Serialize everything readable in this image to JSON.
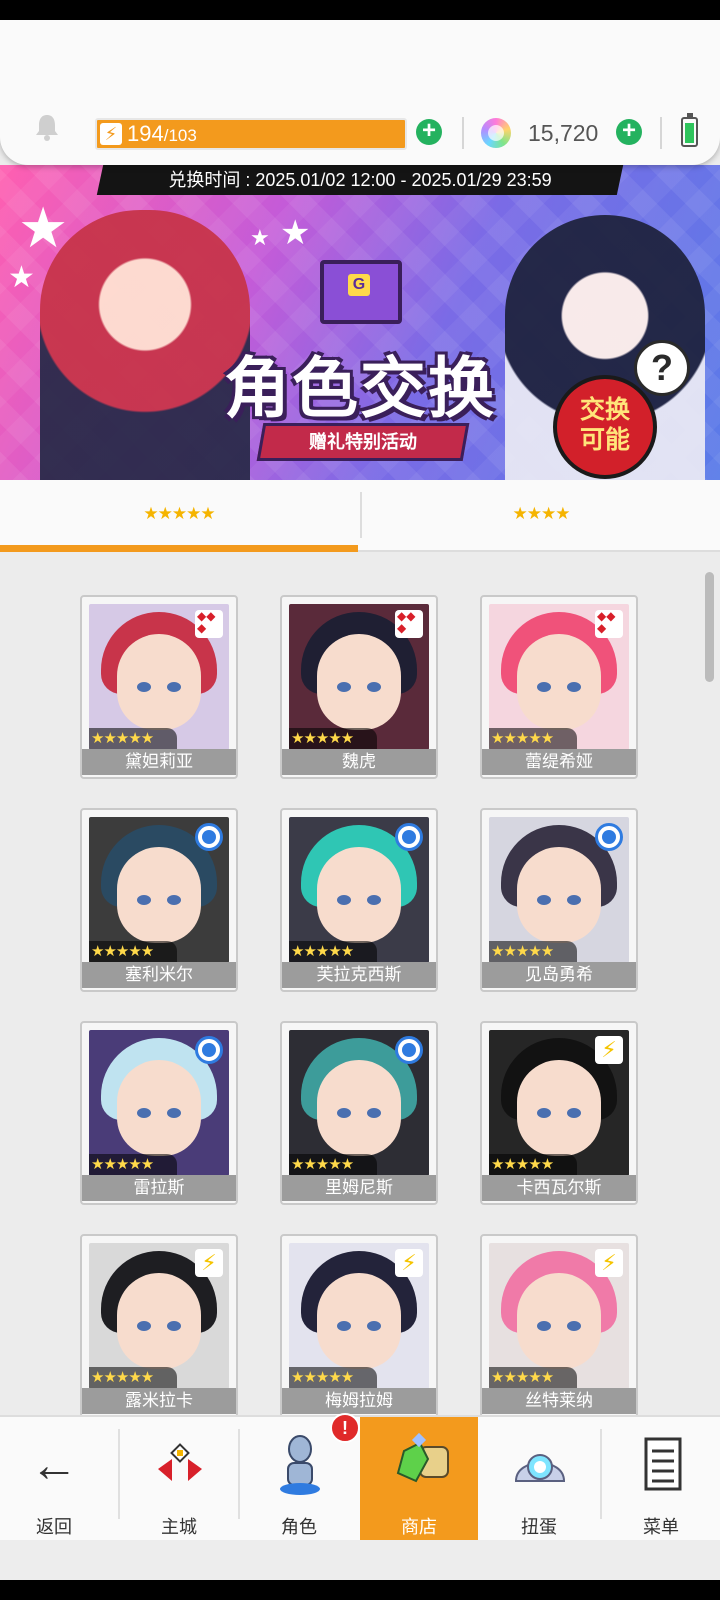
{
  "status": {
    "stamina_current": "194",
    "stamina_max": "/103",
    "gems": "15,720"
  },
  "banner": {
    "period": "兑换时间 : 2025.01/02 12:00 - 2025.01/29 23:59",
    "title": "角色交换",
    "subtitle": "赠礼特别活动",
    "badge_line1": "交换",
    "badge_line2": "可能",
    "help": "?"
  },
  "tabs": [
    {
      "label": "★★★★★",
      "active": true
    },
    {
      "label": "★★★★",
      "active": false
    }
  ],
  "characters": [
    {
      "name": "黛妲莉亚",
      "stars": "★★★★★",
      "type": "fire",
      "hair": "#c8344a",
      "bg": "#d6c9e6"
    },
    {
      "name": "魏虎",
      "stars": "★★★★★",
      "type": "fire",
      "hair": "#1f1f33",
      "bg": "#5a2a3a"
    },
    {
      "name": "蕾缇希娅",
      "stars": "★★★★★",
      "type": "fire",
      "hair": "#f0527a",
      "bg": "#f5d6df"
    },
    {
      "name": "塞利米尔",
      "stars": "★★★★★",
      "type": "water",
      "hair": "#2a4a62",
      "bg": "#3c3c3c"
    },
    {
      "name": "芙拉克西斯",
      "stars": "★★★★★",
      "type": "water",
      "hair": "#2fc6b4",
      "bg": "#3b3b48"
    },
    {
      "name": "见岛勇希",
      "stars": "★★★★★",
      "type": "water",
      "hair": "#3a3548",
      "bg": "#d6d6e0"
    },
    {
      "name": "雷拉斯",
      "stars": "★★★★★",
      "type": "water",
      "hair": "#bfe3f0",
      "bg": "#4a3c78"
    },
    {
      "name": "里姆尼斯",
      "stars": "★★★★★",
      "type": "water",
      "hair": "#3d9c9a",
      "bg": "#2d2d34"
    },
    {
      "name": "卡西瓦尔斯",
      "stars": "★★★★★",
      "type": "bolt",
      "hair": "#121212",
      "bg": "#262626"
    },
    {
      "name": "露米拉卡",
      "stars": "★★★★★",
      "type": "bolt",
      "hair": "#1e1e22",
      "bg": "#d9d9d9"
    },
    {
      "name": "梅姆拉姆",
      "stars": "★★★★★",
      "type": "bolt",
      "hair": "#23233a",
      "bg": "#e3e3ee"
    },
    {
      "name": "丝特莱纳",
      "stars": "★★★★★",
      "type": "bolt",
      "hair": "#f07aa8",
      "bg": "#e7e0e0"
    }
  ],
  "nav": {
    "back": "返回",
    "home": "主城",
    "character": "角色",
    "shop": "商店",
    "gacha": "扭蛋",
    "menu": "菜单",
    "alert": "!"
  },
  "colors": {
    "accent": "#f39a1d",
    "plus": "#24b25f",
    "name_bar": "#9c9c9c"
  }
}
